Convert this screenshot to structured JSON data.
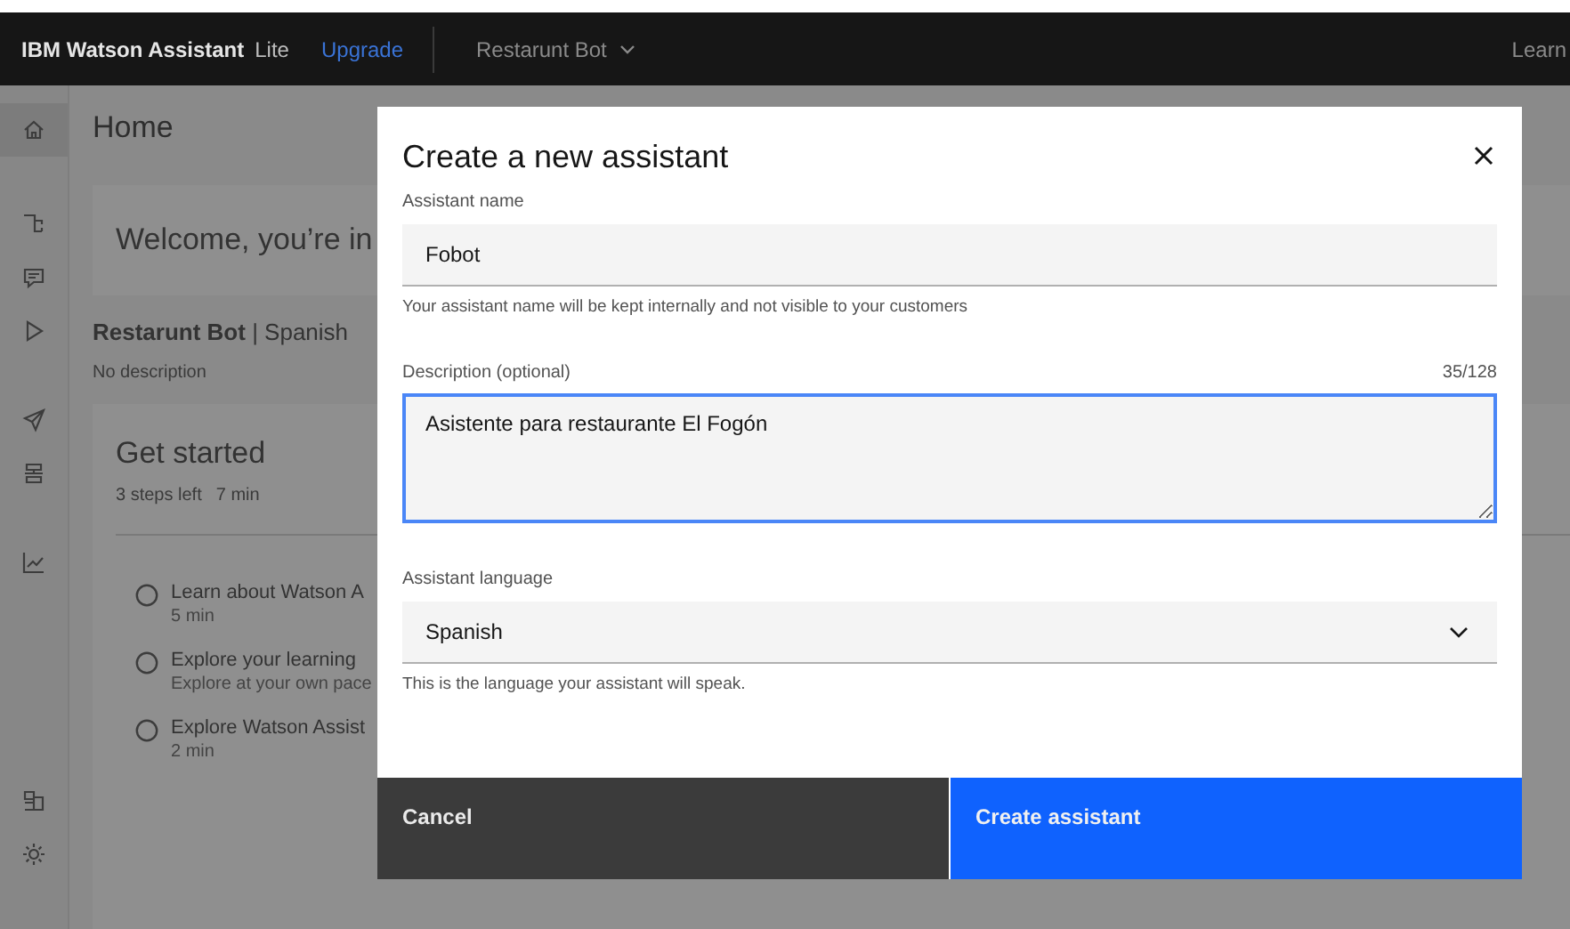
{
  "header": {
    "brand": "IBM Watson Assistant",
    "plan": "Lite",
    "upgrade": "Upgrade",
    "assistant_menu": "Restarunt Bot",
    "learn": "Learn"
  },
  "sidebar": {
    "items": [
      {
        "selected": true
      },
      {
        "selected": false
      },
      {
        "selected": false
      },
      {
        "selected": false
      },
      {
        "selected": false
      },
      {
        "selected": false
      },
      {
        "selected": false
      },
      {
        "selected": false
      },
      {
        "selected": false
      }
    ]
  },
  "page": {
    "title": "Home",
    "welcome": "Welcome, you’re in",
    "assistant": "**Restarunt Bot** | Spanish",
    "description": "No description"
  },
  "get_started": {
    "title": "Get started",
    "steps_left": "3 steps left",
    "time": "7 min",
    "steps": [
      {
        "title": "Learn about Watson A",
        "detail": "5 min",
        "done": false
      },
      {
        "title": "Explore your learning",
        "detail": "Explore at your own pace",
        "done": false
      },
      {
        "title": "Explore Watson Assist",
        "detail": "2 min",
        "done": false
      }
    ]
  },
  "modal": {
    "title": "Create a new assistant",
    "fields": [
      {
        "kind": "text",
        "label": "Assistant name",
        "value": "Fobot",
        "helper": "Your assistant name will be kept internally and not visible to your customers"
      },
      {
        "kind": "textarea",
        "label": "Description (optional)",
        "counter": "35/128",
        "value": "Asistente para restaurante El Fogón",
        "focused": true
      },
      {
        "kind": "select",
        "label": "Assistant language",
        "value": "Spanish",
        "helper": "This is the language your assistant will speak."
      }
    ],
    "buttons": [
      {
        "kind": "secondary",
        "label": "Cancel"
      },
      {
        "kind": "primary",
        "label": "Create assistant"
      }
    ]
  }
}
